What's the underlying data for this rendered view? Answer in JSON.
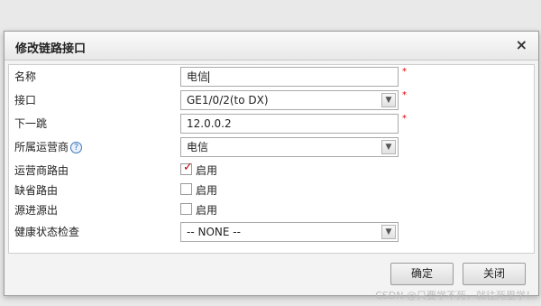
{
  "dialog": {
    "title": "修改链路接口",
    "close_glyph": "×"
  },
  "form": {
    "name": {
      "label": "名称",
      "value": "电信",
      "required": "*"
    },
    "interface": {
      "label": "接口",
      "value": "GE1/0/2(to DX)",
      "required": "*",
      "icon": "chevron-down-icon"
    },
    "next_hop": {
      "label": "下一跳",
      "value": "12.0.0.2",
      "required": "*"
    },
    "isp": {
      "label": "所属运营商",
      "help_glyph": "?",
      "value": "电信",
      "icon": "chevron-down-icon"
    },
    "isp_route": {
      "label": "运营商路由",
      "checkbox_label": "启用",
      "checked": true
    },
    "default_route": {
      "label": "缺省路由",
      "checkbox_label": "启用",
      "checked": false
    },
    "source_in_out": {
      "label": "源进源出",
      "checkbox_label": "启用",
      "checked": false
    },
    "health_check": {
      "label": "健康状态检查",
      "value": "-- NONE --",
      "icon": "chevron-down-icon"
    }
  },
  "buttons": {
    "ok": "确定",
    "close": "关闭"
  },
  "watermark": "CSDN @只要学不死，就往死里学！",
  "colors": {
    "required": "#dd0000",
    "checkmark": "#bb0000",
    "help": "#3d76b8"
  }
}
